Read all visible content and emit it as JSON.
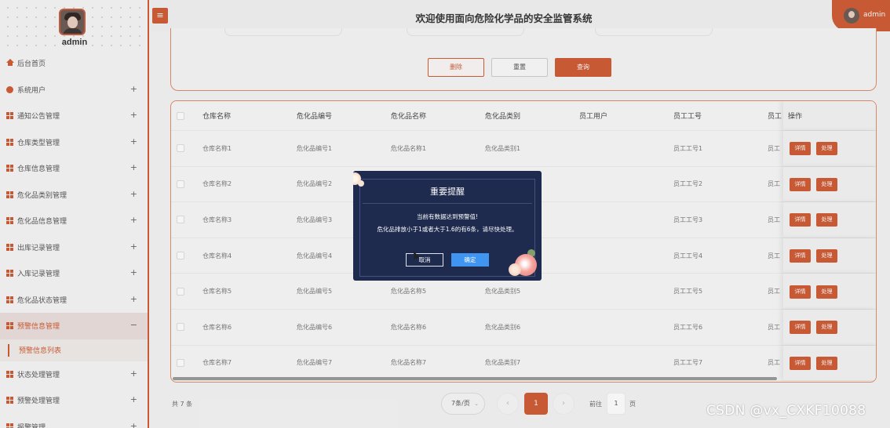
{
  "user": {
    "name": "admin",
    "header_name": "admin"
  },
  "header": {
    "title": "欢迎使用面向危险化学品的安全监管系统",
    "toggle_symbol": "≡"
  },
  "sidebar": {
    "items": [
      {
        "label": "后台首页",
        "icon": "home-icon",
        "expandable": false
      },
      {
        "label": "系统用户",
        "icon": "user-icon",
        "expandable": true
      },
      {
        "label": "通知公告管理",
        "icon": "grid-icon",
        "expandable": true
      },
      {
        "label": "仓库类型管理",
        "icon": "grid-icon",
        "expandable": true
      },
      {
        "label": "仓库信息管理",
        "icon": "grid-icon",
        "expandable": true
      },
      {
        "label": "危化品类别管理",
        "icon": "grid-icon",
        "expandable": true
      },
      {
        "label": "危化品信息管理",
        "icon": "grid-icon",
        "expandable": true
      },
      {
        "label": "出库记录管理",
        "icon": "grid-icon",
        "expandable": true
      },
      {
        "label": "入库记录管理",
        "icon": "grid-icon",
        "expandable": true
      },
      {
        "label": "危化品状态管理",
        "icon": "grid-icon",
        "expandable": true
      },
      {
        "label": "预警信息管理",
        "icon": "grid-icon",
        "expandable": true,
        "active": true,
        "toggle": "−"
      },
      {
        "label": "状态处理管理",
        "icon": "grid-icon",
        "expandable": true
      },
      {
        "label": "预警处理管理",
        "icon": "grid-icon",
        "expandable": true
      },
      {
        "label": "报警管理",
        "icon": "grid-icon",
        "expandable": true
      }
    ],
    "sub_item": "预警信息列表",
    "plus_symbol": "+"
  },
  "search": {
    "delete_label": "删除",
    "reset_label": "重置",
    "query_label": "查询"
  },
  "table": {
    "columns": [
      "仓库名称",
      "危化品编号",
      "危化品名称",
      "危化品类别",
      "员工用户",
      "员工工号",
      "员工",
      "操作"
    ],
    "rows": [
      [
        "仓库名称1",
        "危化品编号1",
        "危化品名称1",
        "危化品类别1",
        "",
        "员工工号1",
        "员工"
      ],
      [
        "仓库名称2",
        "危化品编号2",
        "",
        "",
        "",
        "员工工号2",
        "员工"
      ],
      [
        "仓库名称3",
        "危化品编号3",
        "",
        "",
        "",
        "员工工号3",
        "员工"
      ],
      [
        "仓库名称4",
        "危化品编号4",
        "",
        "",
        "",
        "员工工号4",
        "员工"
      ],
      [
        "仓库名称5",
        "危化品编号5",
        "危化品名称5",
        "危化品类别5",
        "",
        "员工工号5",
        "员工"
      ],
      [
        "仓库名称6",
        "危化品编号6",
        "危化品名称6",
        "危化品类别6",
        "",
        "员工工号6",
        "员工"
      ],
      [
        "仓库名称7",
        "危化品编号7",
        "危化品名称7",
        "危化品类别7",
        "",
        "员工工号7",
        "员工"
      ]
    ],
    "op_detail": "详情",
    "op_process": "处理"
  },
  "pagination": {
    "total": "共 7 条",
    "page_size": "7条/页",
    "prev": "‹",
    "next": "›",
    "current_page": "1",
    "goto_label": "前往",
    "goto_value": "1",
    "goto_unit": "页"
  },
  "dialog": {
    "title": "重要提醒",
    "line1": "当前有数据达到预警值!",
    "line2": "危化品排放小于1或者大于1.6的有6条，请尽快处理。",
    "cancel": "取消",
    "ok": "确定"
  },
  "watermark": "CSDN @vx_CXKF10088",
  "colors": {
    "accent": "#cf5a34",
    "dialog_bg": "#1e2a4e",
    "ok_button": "#3f95f0"
  }
}
